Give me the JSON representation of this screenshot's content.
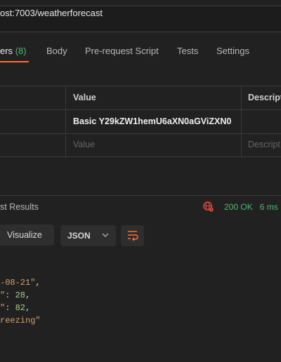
{
  "request": {
    "url": "ost:7003/weatherforecast"
  },
  "request_tabs": [
    {
      "label": "ers",
      "count": "(8)"
    },
    {
      "label": "Body"
    },
    {
      "label": "Pre-request Script"
    },
    {
      "label": "Tests"
    },
    {
      "label": "Settings"
    }
  ],
  "headers_table": {
    "columns": [
      "Value",
      "Descript"
    ],
    "rows": [
      {
        "value": "Basic Y29kZW1hemU6aXN0aGViZXN0",
        "description": ""
      }
    ],
    "new_row": {
      "value_placeholder": "Value",
      "description_placeholder": "Descript"
    }
  },
  "response": {
    "tab_label": "st Results",
    "status": "200 OK",
    "time": "6 ms",
    "visualize_label": "Visualize",
    "format": "JSON",
    "lines": [
      {
        "text": "-08-21\"",
        "trail": ","
      },
      {
        "key_tail": "\"",
        "value": "28",
        "trail": ","
      },
      {
        "key_tail": "\"",
        "value": "82",
        "trail": ","
      },
      {
        "text": "reezing\"",
        "trail": ""
      }
    ]
  },
  "colors": {
    "accent": "#ff6c37",
    "success": "#53b871",
    "background": "#212121"
  },
  "icons": {
    "globe": "globe-error-icon",
    "wrap": "wrap-lines-icon",
    "chevron": "chevron-down-icon"
  }
}
